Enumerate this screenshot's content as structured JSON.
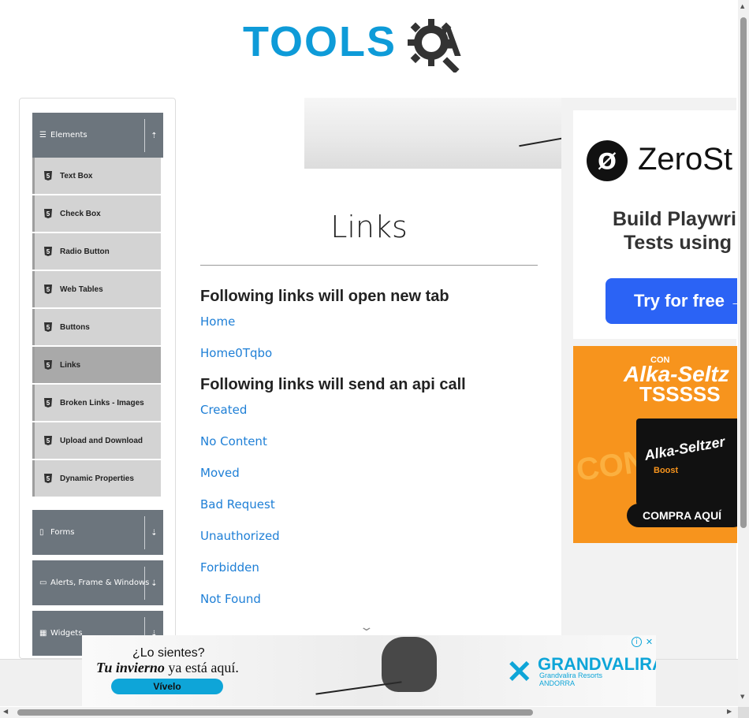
{
  "header": {
    "logo_text_left": "TOOLS",
    "logo_text_right": "A",
    "logo_colors": {
      "tools": "#0e9bd8",
      "qa": "#333333"
    }
  },
  "sidebar": {
    "groups": [
      {
        "label": "Elements",
        "icon": "hamburger-icon",
        "toggle_icon": "collapse-up-icon",
        "expanded": true
      },
      {
        "label": "Forms",
        "icon": "document-icon",
        "toggle_icon": "expand-down-icon",
        "expanded": false
      },
      {
        "label": "Alerts, Frame & Windows",
        "icon": "window-icon",
        "toggle_icon": "expand-down-icon",
        "expanded": false
      },
      {
        "label": "Widgets",
        "icon": "grid-icon",
        "toggle_icon": "expand-down-icon",
        "expanded": false
      }
    ],
    "items": [
      {
        "label": "Text Box"
      },
      {
        "label": "Check Box"
      },
      {
        "label": "Radio Button"
      },
      {
        "label": "Web Tables"
      },
      {
        "label": "Buttons"
      },
      {
        "label": "Links",
        "active": true
      },
      {
        "label": "Broken Links - Images"
      },
      {
        "label": "Upload and Download"
      },
      {
        "label": "Dynamic Properties"
      }
    ],
    "colors": {
      "group_header": "#6c757d",
      "item_bg": "#d3d3d3",
      "active_bg": "#a9a9a9"
    }
  },
  "main": {
    "title": "Links",
    "section1": {
      "heading": "Following links will open new tab",
      "links": [
        "Home",
        "Home0Tqbo"
      ]
    },
    "section2": {
      "heading": "Following links will send an api call",
      "links": [
        "Created",
        "No Content",
        "Moved",
        "Bad Request",
        "Unauthorized",
        "Forbidden",
        "Not Found"
      ]
    },
    "link_color": "#1e7fd6"
  },
  "ads": {
    "zerostep": {
      "brand": "ZeroSt",
      "line1": "Build Playwri",
      "line2": "Tests using",
      "cta": "Try for free →"
    },
    "alka": {
      "con": "CON",
      "name": "Alka-Seltz",
      "tss": "TSSSSS",
      "box_label": "Alka-Seltzer",
      "box_sub": "Boost",
      "side": "CON",
      "cta": "COMPRA AQUÍ"
    },
    "bottom": {
      "line1": "¿Lo sientes?",
      "line2_em": "Tu invierno",
      "line2_rest": " ya está aquí.",
      "cta": "Vívelo",
      "brand": "GRANDVALIRA",
      "sub1": "Grandvalira Resorts",
      "sub2": "ANDORRA",
      "info": "i",
      "close": "✕"
    }
  }
}
